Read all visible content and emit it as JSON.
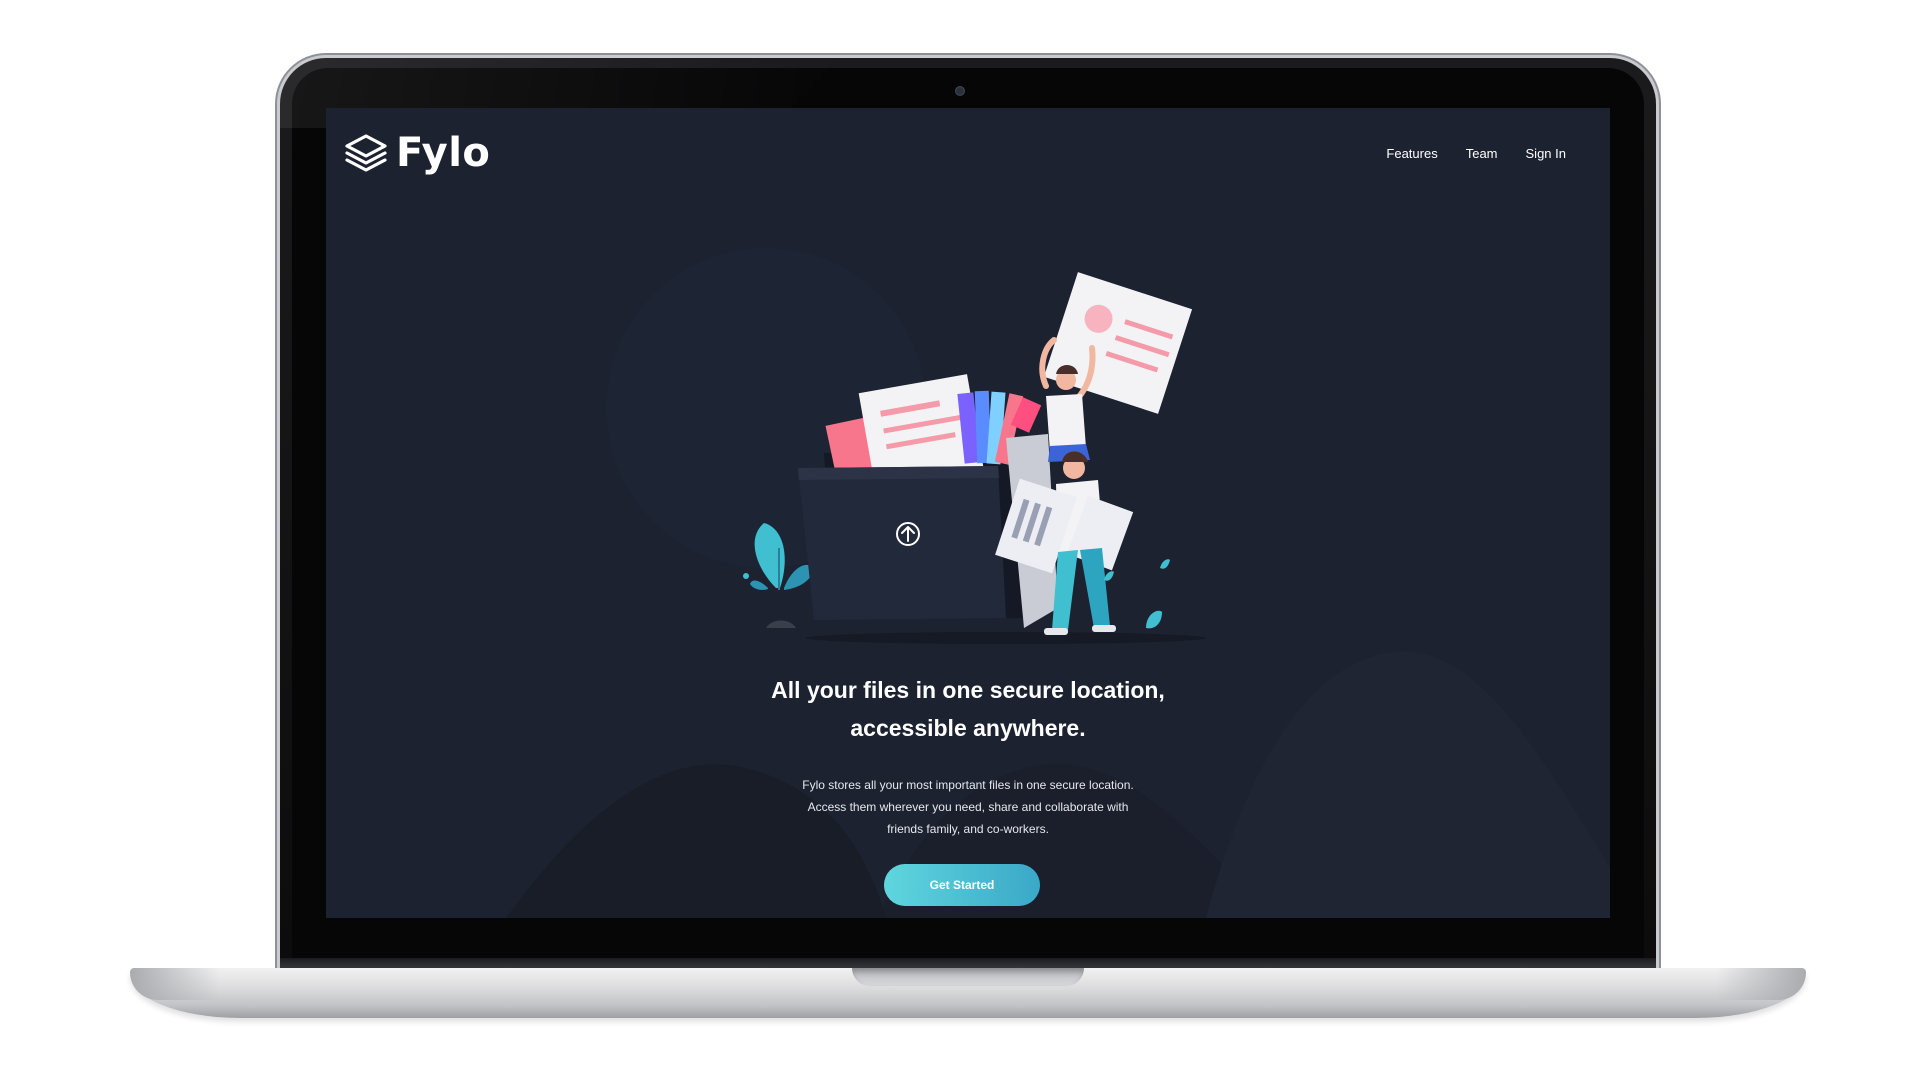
{
  "brand": {
    "name": "Fylo",
    "logo_icon": "layers-icon"
  },
  "nav": {
    "links": [
      "Features",
      "Team",
      "Sign In"
    ]
  },
  "hero": {
    "headline_line1": "All your files in one secure location,",
    "headline_line2": "accessible anywhere.",
    "description_line1": "Fylo stores all your most important files in one secure location.",
    "description_line2": "Access them wherever you need, share and collaborate with",
    "description_line3": "friends family, and co-workers.",
    "cta_label": "Get Started"
  },
  "icons": {
    "upload": "upload-arrow-icon",
    "camera": "webcam-icon"
  },
  "colors": {
    "background": "#1c2230",
    "accent_start": "#5fd6de",
    "accent_end": "#3aa8c8",
    "text": "#ffffff"
  }
}
